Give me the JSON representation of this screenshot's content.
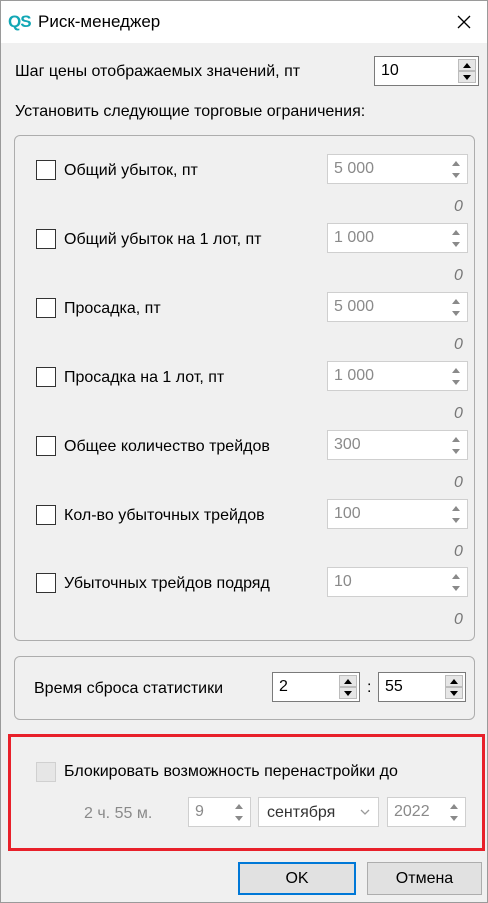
{
  "window": {
    "title": "Риск-менеджер",
    "app_icon_text": "QS",
    "close_glyph": "✕"
  },
  "price_step": {
    "label": "Шаг цены отображаемых значений, пт",
    "value": "10"
  },
  "limits_heading": "Установить следующие торговые ограничения:",
  "limits": [
    {
      "label": "Общий убыток, пт",
      "value": "5 000",
      "used": "0",
      "checked": false
    },
    {
      "label": "Общий убыток на 1 лот, пт",
      "value": "1 000",
      "used": "0",
      "checked": false
    },
    {
      "label": "Просадка, пт",
      "value": "5 000",
      "used": "0",
      "checked": false
    },
    {
      "label": "Просадка на 1 лот, пт",
      "value": "1 000",
      "used": "0",
      "checked": false
    },
    {
      "label": "Общее количество трейдов",
      "value": "300",
      "used": "0",
      "checked": false
    },
    {
      "label": "Кол-во убыточных трейдов",
      "value": "100",
      "used": "0",
      "checked": false
    },
    {
      "label": "Убыточных трейдов подряд",
      "value": "10",
      "used": "0",
      "checked": false
    }
  ],
  "reset_time": {
    "label": "Время сброса статистики",
    "hours": "2",
    "separator": ":",
    "minutes": "55"
  },
  "block": {
    "label": "Блокировать возможность перенастройки до",
    "checked": false,
    "remaining": "2 ч.  55 м.",
    "day": "9",
    "month": "сентября",
    "year": "2022"
  },
  "buttons": {
    "ok": "OK",
    "cancel": "Отмена"
  },
  "colors": {
    "accent": "#0078d7",
    "highlight": "#e8202a",
    "app_icon": "#12a7b5"
  },
  "icons": {
    "spin_up": "triangle-up-icon",
    "spin_down": "triangle-down-icon",
    "combo": "chevron-down-icon"
  }
}
